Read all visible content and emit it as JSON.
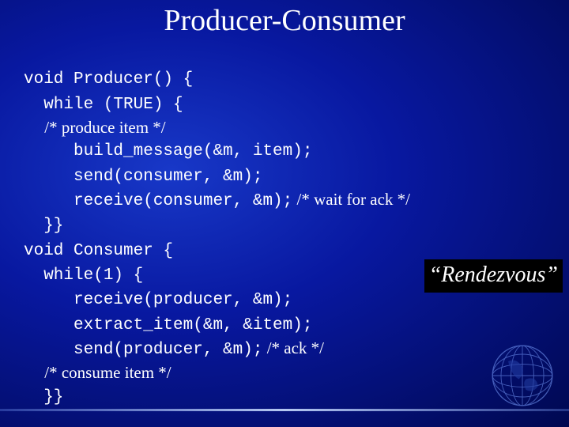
{
  "title": "Producer-Consumer",
  "code": {
    "l1a": "void Producer() {",
    "l2a": "  while (TRUE) {",
    "l3s": "     /* produce item */",
    "l4a": "     build_message(&m, item);",
    "l5a": "     send(consumer, &m);",
    "l6a": "     receive(consumer, &m);",
    "l6s": " /* wait for ack */",
    "l7a": "  }}",
    "l8a": "void Consumer {",
    "l9a": "  while(1) {",
    "l10a": "     receive(producer, &m);",
    "l11a": "     extract_item(&m, &item);",
    "l12a": "     send(producer, &m);",
    "l12s": " /* ack */",
    "l13s": "     /* consume item */",
    "l14a": "  }}"
  },
  "callout": "“Rendezvous”"
}
